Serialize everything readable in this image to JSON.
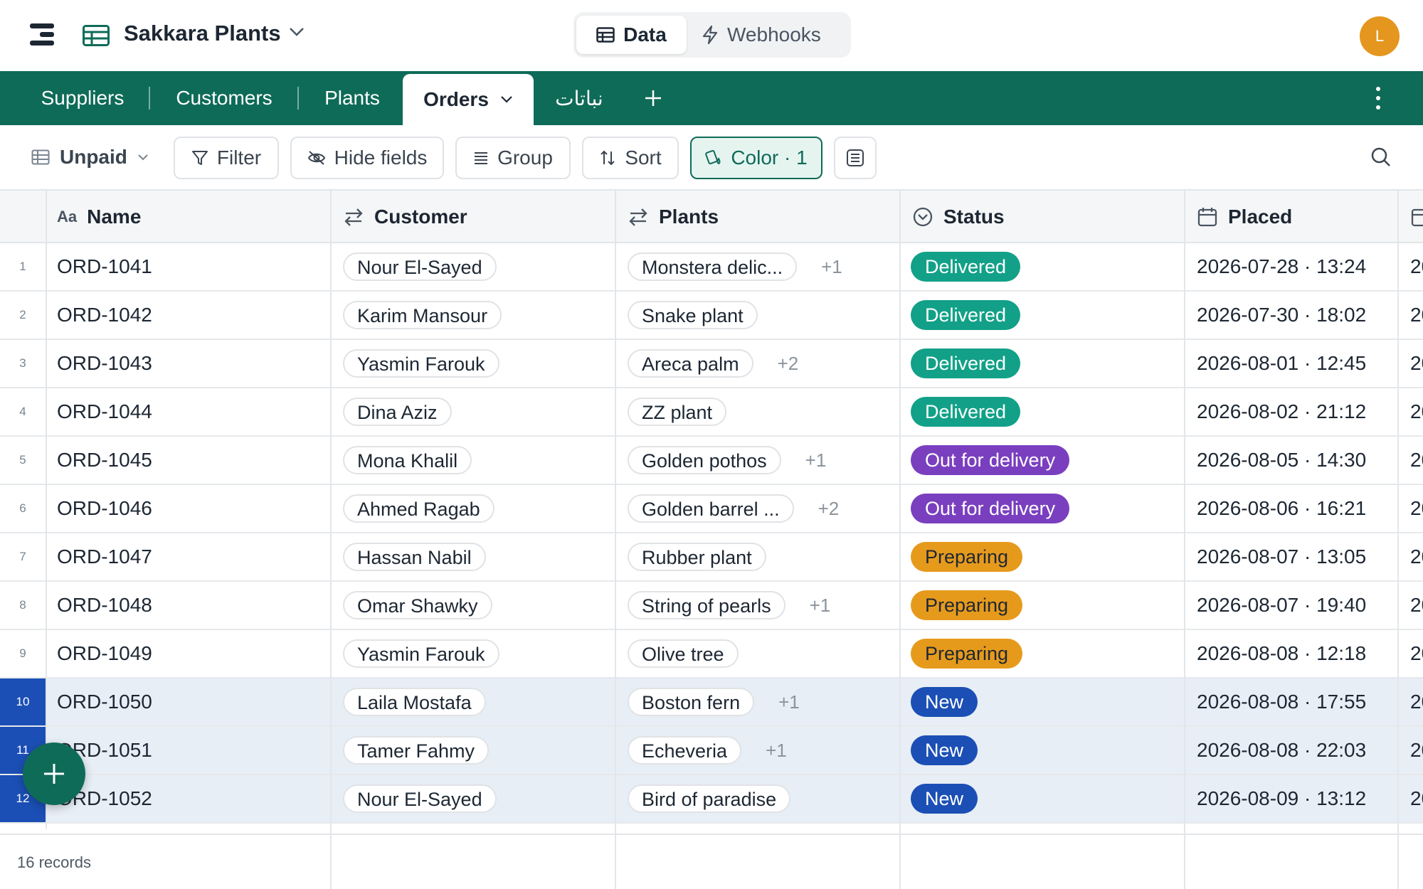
{
  "app": {
    "base_name": "Sakkara Plants",
    "modes": {
      "data": "Data",
      "webhooks": "Webhooks"
    },
    "avatar_initial": "L"
  },
  "tabs": [
    {
      "label": "Suppliers",
      "active": false
    },
    {
      "label": "Customers",
      "active": false
    },
    {
      "label": "Plants",
      "active": false
    },
    {
      "label": "Orders",
      "active": true
    },
    {
      "label": "نباتات",
      "active": false
    }
  ],
  "toolbar": {
    "view": "Unpaid",
    "filter": "Filter",
    "hide_fields": "Hide fields",
    "group": "Group",
    "sort": "Sort",
    "color": "Color · 1"
  },
  "columns": {
    "name": "Name",
    "name_type": "Aa",
    "customer": "Customer",
    "plants": "Plants",
    "status": "Status",
    "placed": "Placed"
  },
  "rows": [
    {
      "num": "1",
      "name": "ORD-1041",
      "customer": "Nour El-Sayed",
      "plant": "Monstera delic...",
      "more": "+1",
      "status": "Delivered",
      "status_key": "delivered",
      "placed": "2026-07-28 · 13:24",
      "next": "20",
      "selected": false
    },
    {
      "num": "2",
      "name": "ORD-1042",
      "customer": "Karim Mansour",
      "plant": "Snake plant",
      "more": "",
      "status": "Delivered",
      "status_key": "delivered",
      "placed": "2026-07-30 · 18:02",
      "next": "20",
      "selected": false
    },
    {
      "num": "3",
      "name": "ORD-1043",
      "customer": "Yasmin Farouk",
      "plant": "Areca palm",
      "more": "+2",
      "status": "Delivered",
      "status_key": "delivered",
      "placed": "2026-08-01 · 12:45",
      "next": "20",
      "selected": false
    },
    {
      "num": "4",
      "name": "ORD-1044",
      "customer": "Dina Aziz",
      "plant": "ZZ plant",
      "more": "",
      "status": "Delivered",
      "status_key": "delivered",
      "placed": "2026-08-02 · 21:12",
      "next": "20",
      "selected": false
    },
    {
      "num": "5",
      "name": "ORD-1045",
      "customer": "Mona Khalil",
      "plant": "Golden pothos",
      "more": "+1",
      "status": "Out for delivery",
      "status_key": "out",
      "placed": "2026-08-05 · 14:30",
      "next": "20",
      "selected": false
    },
    {
      "num": "6",
      "name": "ORD-1046",
      "customer": "Ahmed Ragab",
      "plant": "Golden barrel ...",
      "more": "+2",
      "status": "Out for delivery",
      "status_key": "out",
      "placed": "2026-08-06 · 16:21",
      "next": "20",
      "selected": false
    },
    {
      "num": "7",
      "name": "ORD-1047",
      "customer": "Hassan Nabil",
      "plant": "Rubber plant",
      "more": "",
      "status": "Preparing",
      "status_key": "preparing",
      "placed": "2026-08-07 · 13:05",
      "next": "20",
      "selected": false
    },
    {
      "num": "8",
      "name": "ORD-1048",
      "customer": "Omar Shawky",
      "plant": "String of pearls",
      "more": "+1",
      "status": "Preparing",
      "status_key": "preparing",
      "placed": "2026-08-07 · 19:40",
      "next": "20",
      "selected": false
    },
    {
      "num": "9",
      "name": "ORD-1049",
      "customer": "Yasmin Farouk",
      "plant": "Olive tree",
      "more": "",
      "status": "Preparing",
      "status_key": "preparing",
      "placed": "2026-08-08 · 12:18",
      "next": "20",
      "selected": false
    },
    {
      "num": "10",
      "name": "ORD-1050",
      "customer": "Laila Mostafa",
      "plant": "Boston fern",
      "more": "+1",
      "status": "New",
      "status_key": "new",
      "placed": "2026-08-08 · 17:55",
      "next": "20",
      "selected": true
    },
    {
      "num": "11",
      "name": "ORD-1051",
      "customer": "Tamer Fahmy",
      "plant": "Echeveria",
      "more": "+1",
      "status": "New",
      "status_key": "new",
      "placed": "2026-08-08 · 22:03",
      "next": "20",
      "selected": true
    },
    {
      "num": "12",
      "name": "ORD-1052",
      "customer": "Nour El-Sayed",
      "plant": "Bird of paradise",
      "more": "",
      "status": "New",
      "status_key": "new",
      "placed": "2026-08-09 · 13:12",
      "next": "20",
      "selected": true
    }
  ],
  "footer": {
    "records": "16 records"
  },
  "colors": {
    "brand": "#0e6b58",
    "delivered": "#12a188",
    "out_for_delivery": "#7a3fbf",
    "preparing": "#e69a1c",
    "new": "#1b4fb5",
    "avatar": "#e5961e"
  }
}
